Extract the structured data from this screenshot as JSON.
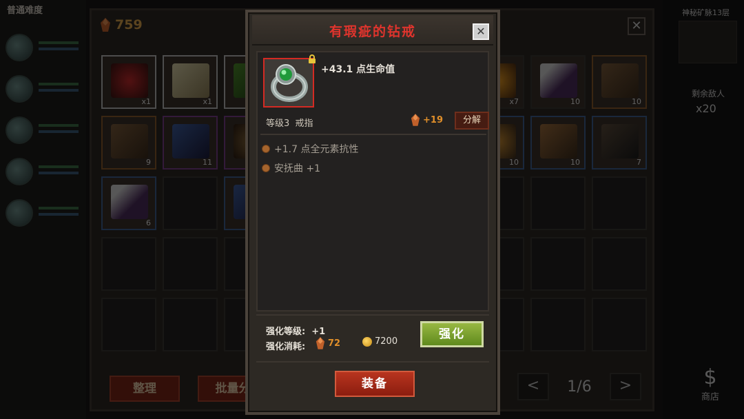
{
  "background": {
    "top_left_title": "普通难度",
    "resource_count": "759",
    "slots": [
      {
        "count": "x1",
        "tone": "white",
        "art": "red-gem"
      },
      {
        "count": "x1",
        "tone": "white",
        "art": "scroll"
      },
      {
        "count": "",
        "tone": "white",
        "art": "green"
      },
      {
        "count": "x7",
        "tone": "",
        "art": "orange"
      },
      {
        "count": "10",
        "tone": "",
        "art": "dagger"
      },
      {
        "count": "10",
        "tone": "orange",
        "art": "bundle"
      },
      {
        "count": "9",
        "tone": "orange",
        "art": "bundle"
      },
      {
        "count": "11",
        "tone": "purple",
        "art": "axe"
      },
      {
        "count": "",
        "tone": "purple",
        "art": "shield"
      },
      {
        "count": "10",
        "tone": "blue",
        "art": "orange"
      },
      {
        "count": "10",
        "tone": "blue",
        "art": "boots"
      },
      {
        "count": "7",
        "tone": "blue",
        "art": "bow"
      },
      {
        "count": "6",
        "tone": "blue",
        "art": "dagger"
      },
      {
        "count": "",
        "tone": "blue",
        "art": "axe"
      }
    ],
    "buttons": {
      "sort": "整理",
      "batch": "批量分"
    },
    "pager": {
      "prev": "<",
      "page": "1/6",
      "next": ">"
    },
    "right_panel": {
      "title": "神秘矿脉13层",
      "label": "剩余敌人",
      "count": "x20",
      "shop": "商店",
      "shop_icon": "$"
    }
  },
  "popup": {
    "title": "有瑕疵的钻戒",
    "close": "✕",
    "item": {
      "main_stat": "+43.1 点生命值",
      "level": "等级3",
      "type": "戒指",
      "salvage_value": "+19",
      "salvage_button": "分解",
      "affixes": [
        "+1.7 点全元素抗性",
        "安抚曲 +1"
      ]
    },
    "enhance": {
      "level_label": "强化等级:",
      "level_value": "+1",
      "cost_label": "强化消耗:",
      "cost_material": "72",
      "cost_gold": "7200",
      "button": "强化"
    },
    "equip_button": "装备"
  },
  "colors": {
    "title_red": "#e0342d",
    "rare_border": "#d52a23",
    "enhance_green": "#7aa02f",
    "equip_red": "#a42a18",
    "material_orange": "#e08f2a"
  }
}
